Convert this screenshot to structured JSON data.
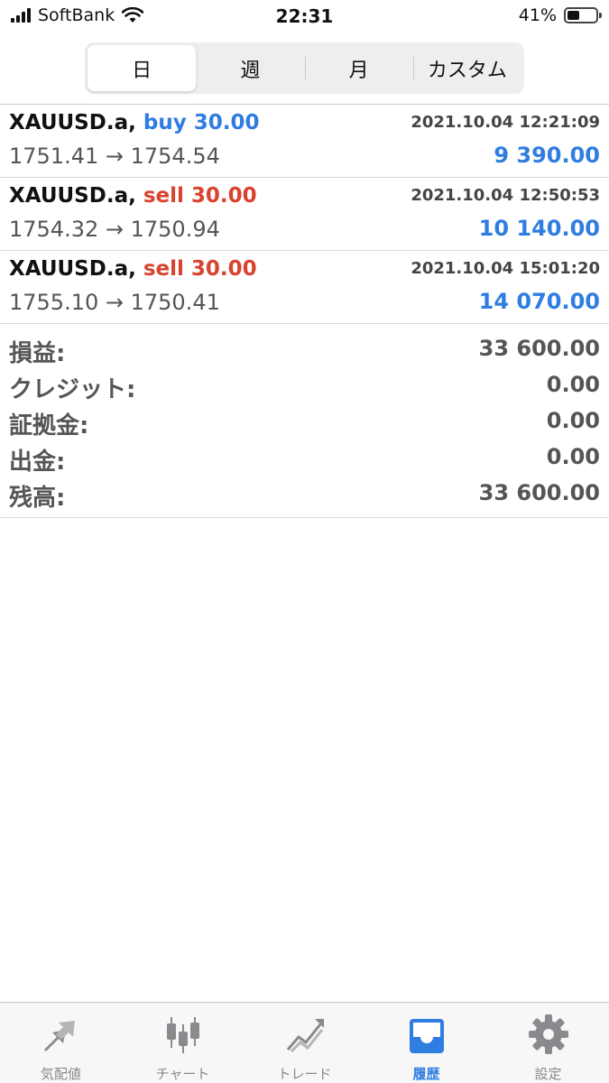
{
  "status_bar": {
    "carrier": "SoftBank",
    "time": "22:31",
    "battery": "41%"
  },
  "segments": [
    "日",
    "週",
    "月",
    "カスタム"
  ],
  "selected_segment": "日",
  "deals": [
    {
      "symbol": "XAUUSD.a,",
      "side": "buy 30.00",
      "type": "buy",
      "datetime": "2021.10.04 12:21:09",
      "prices": "1751.41 → 1754.54",
      "profit": "9 390.00"
    },
    {
      "symbol": "XAUUSD.a,",
      "side": "sell 30.00",
      "type": "sell",
      "datetime": "2021.10.04 12:50:53",
      "prices": "1754.32 → 1750.94",
      "profit": "10 140.00"
    },
    {
      "symbol": "XAUUSD.a,",
      "side": "sell 30.00",
      "type": "sell",
      "datetime": "2021.10.04 15:01:20",
      "prices": "1755.10 → 1750.41",
      "profit": "14 070.00"
    }
  ],
  "summary": [
    {
      "label": "損益:",
      "value": "33 600.00"
    },
    {
      "label": "クレジット:",
      "value": "0.00"
    },
    {
      "label": "証拠金:",
      "value": "0.00"
    },
    {
      "label": "出金:",
      "value": "0.00"
    },
    {
      "label": "残高:",
      "value": "33 600.00"
    }
  ],
  "tabs": [
    {
      "label": "気配値",
      "icon": "quotes-icon"
    },
    {
      "label": "チャート",
      "icon": "chart-icon"
    },
    {
      "label": "トレード",
      "icon": "trade-icon"
    },
    {
      "label": "履歴",
      "icon": "history-icon",
      "active": true
    },
    {
      "label": "設定",
      "icon": "settings-icon"
    }
  ],
  "colors": {
    "accent": "#2f7de1",
    "sell": "#d9432f",
    "inactive": "#888888"
  }
}
